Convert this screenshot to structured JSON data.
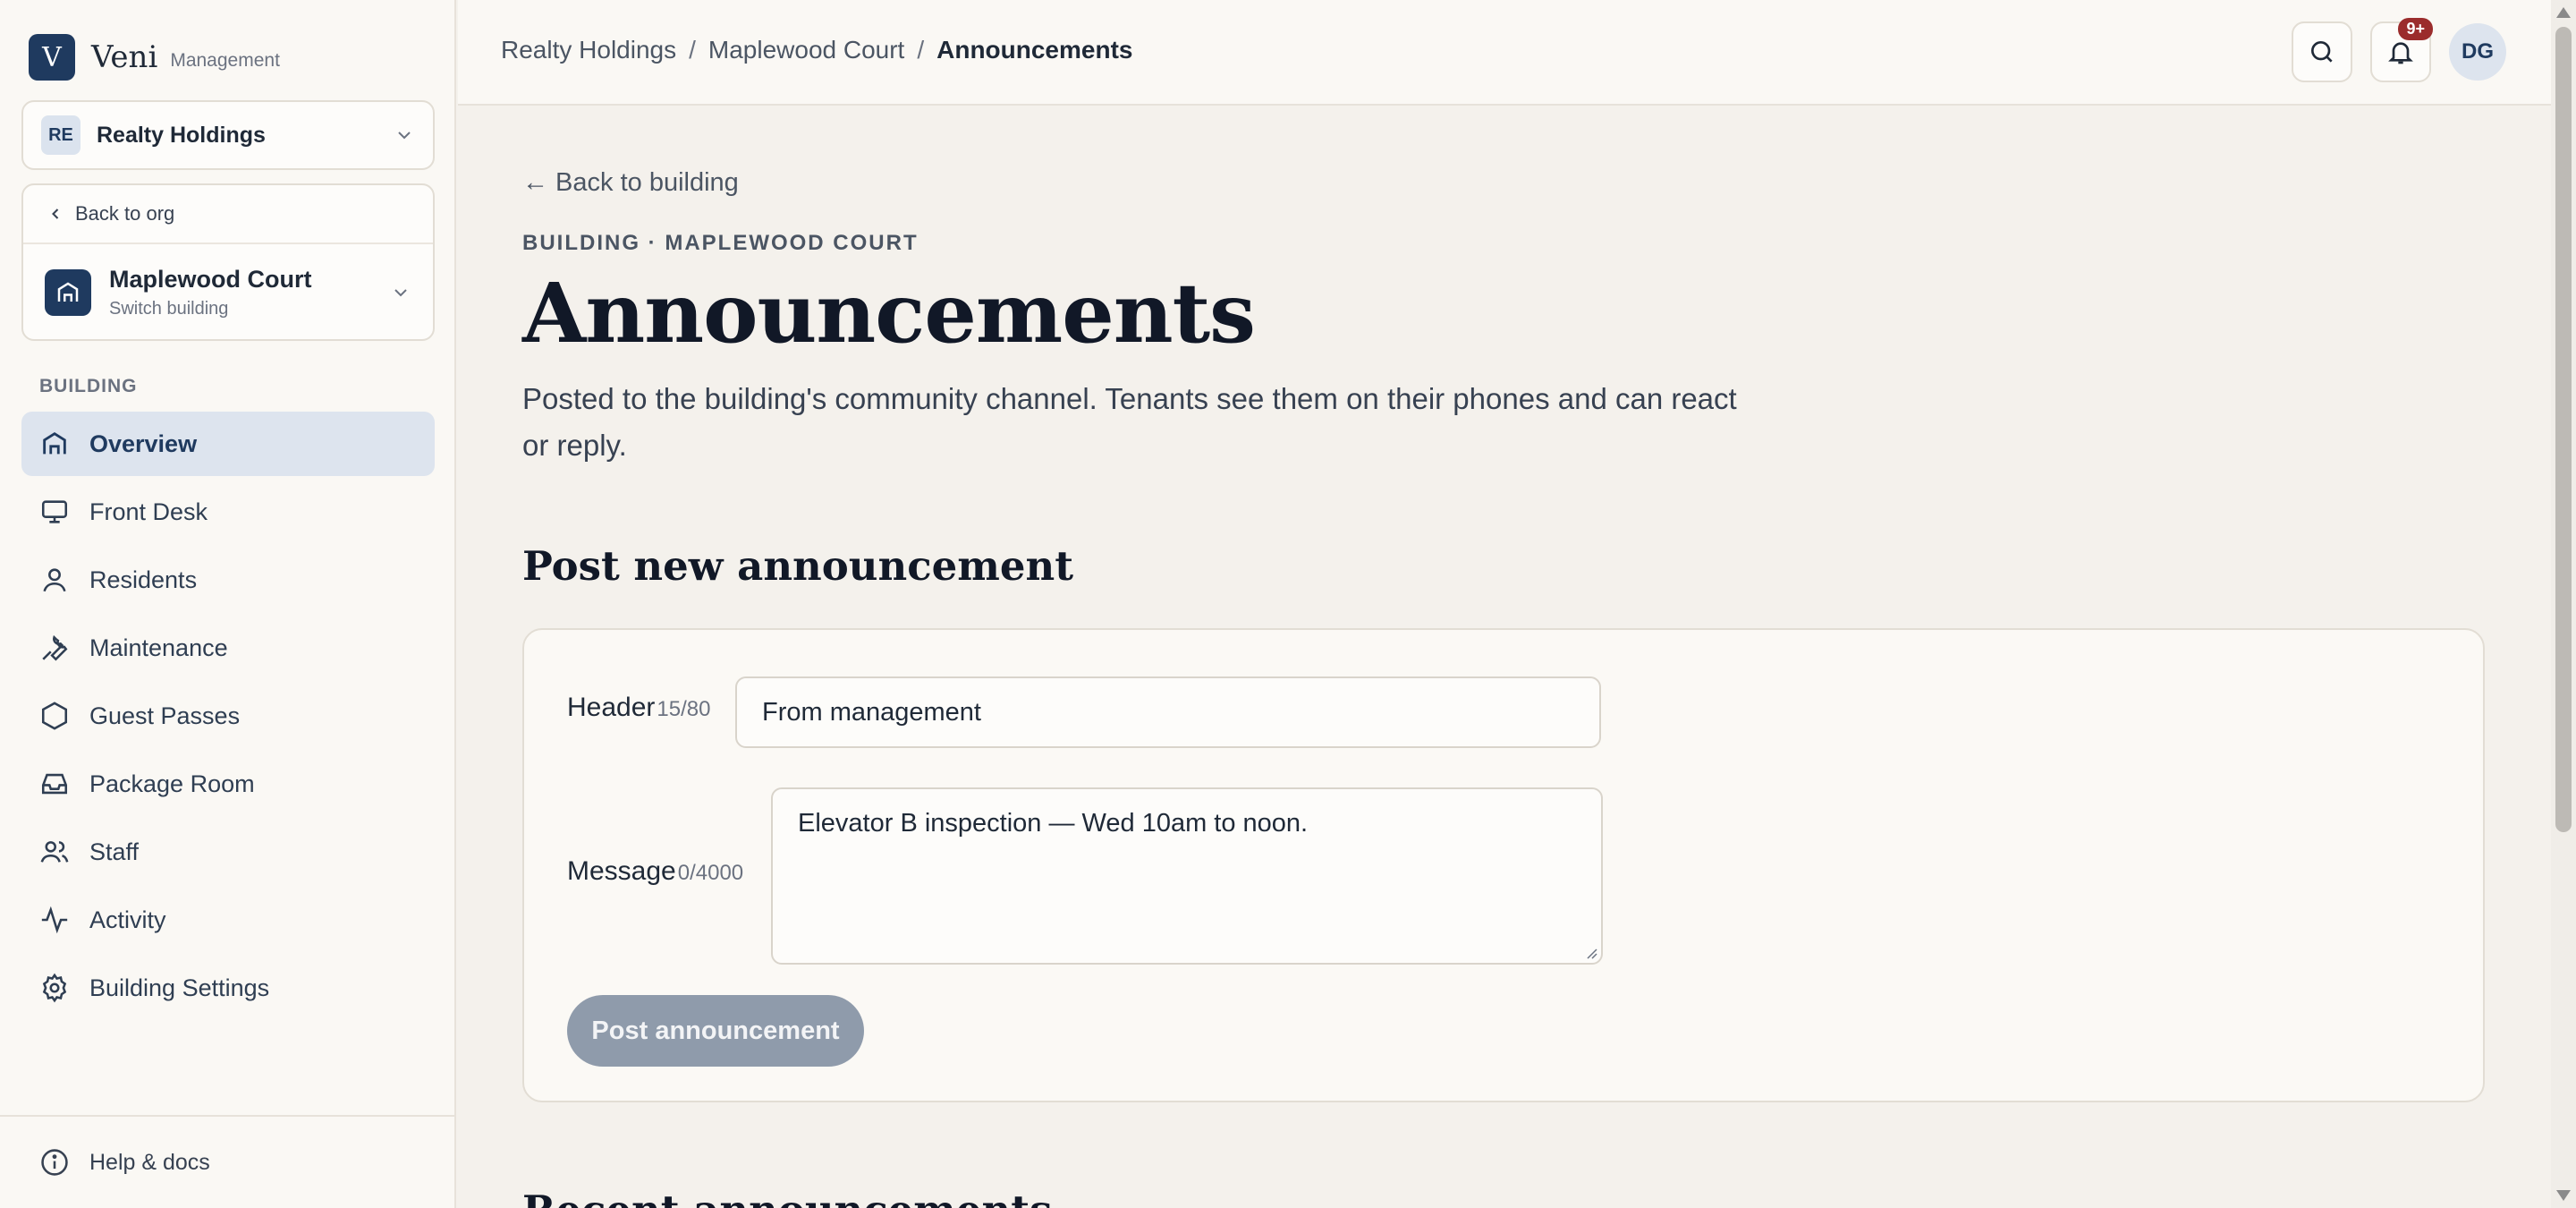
{
  "brand": {
    "name": "Veni",
    "sub": "Management",
    "logo_letter": "V"
  },
  "org": {
    "badge": "RE",
    "name": "Realty Holdings"
  },
  "building": {
    "back_label": "Back to org",
    "name": "Maplewood Court",
    "sub": "Switch building"
  },
  "sidebar": {
    "section": "BUILDING",
    "items": [
      {
        "label": "Overview",
        "icon": "home-icon",
        "active": true
      },
      {
        "label": "Front Desk",
        "icon": "monitor-icon"
      },
      {
        "label": "Residents",
        "icon": "user-icon"
      },
      {
        "label": "Maintenance",
        "icon": "wrench-icon"
      },
      {
        "label": "Guest Passes",
        "icon": "hexagon-icon"
      },
      {
        "label": "Package Room",
        "icon": "inbox-icon"
      },
      {
        "label": "Staff",
        "icon": "users-icon"
      },
      {
        "label": "Activity",
        "icon": "activity-icon"
      },
      {
        "label": "Building Settings",
        "icon": "gear-icon"
      }
    ],
    "help": "Help & docs"
  },
  "topbar": {
    "breadcrumbs": [
      "Realty Holdings",
      "Maplewood Court",
      "Announcements"
    ],
    "separator": "/",
    "notif_count": "9+",
    "avatar": "DG"
  },
  "main": {
    "back_link": "← Back to building",
    "eyebrow": "BUILDING · MAPLEWOOD COURT",
    "title": "Announcements",
    "description": "Posted to the building's community channel. Tenants see them on their phones and can react or reply.",
    "form_title": "Post new announcement",
    "header_label": "Header",
    "header_counter": "15/80",
    "header_value": "From management",
    "message_label": "Message",
    "message_counter": "0/4000",
    "message_value": "Elevator B inspection — Wed 10am to noon.",
    "post_button": "Post announcement",
    "recent_title": "Recent announcements"
  },
  "colors": {
    "accent": "#1f3a5f",
    "active_bg": "#dde4ee",
    "badge": "#9b2c2c",
    "disabled_button": "#8f9bab"
  }
}
